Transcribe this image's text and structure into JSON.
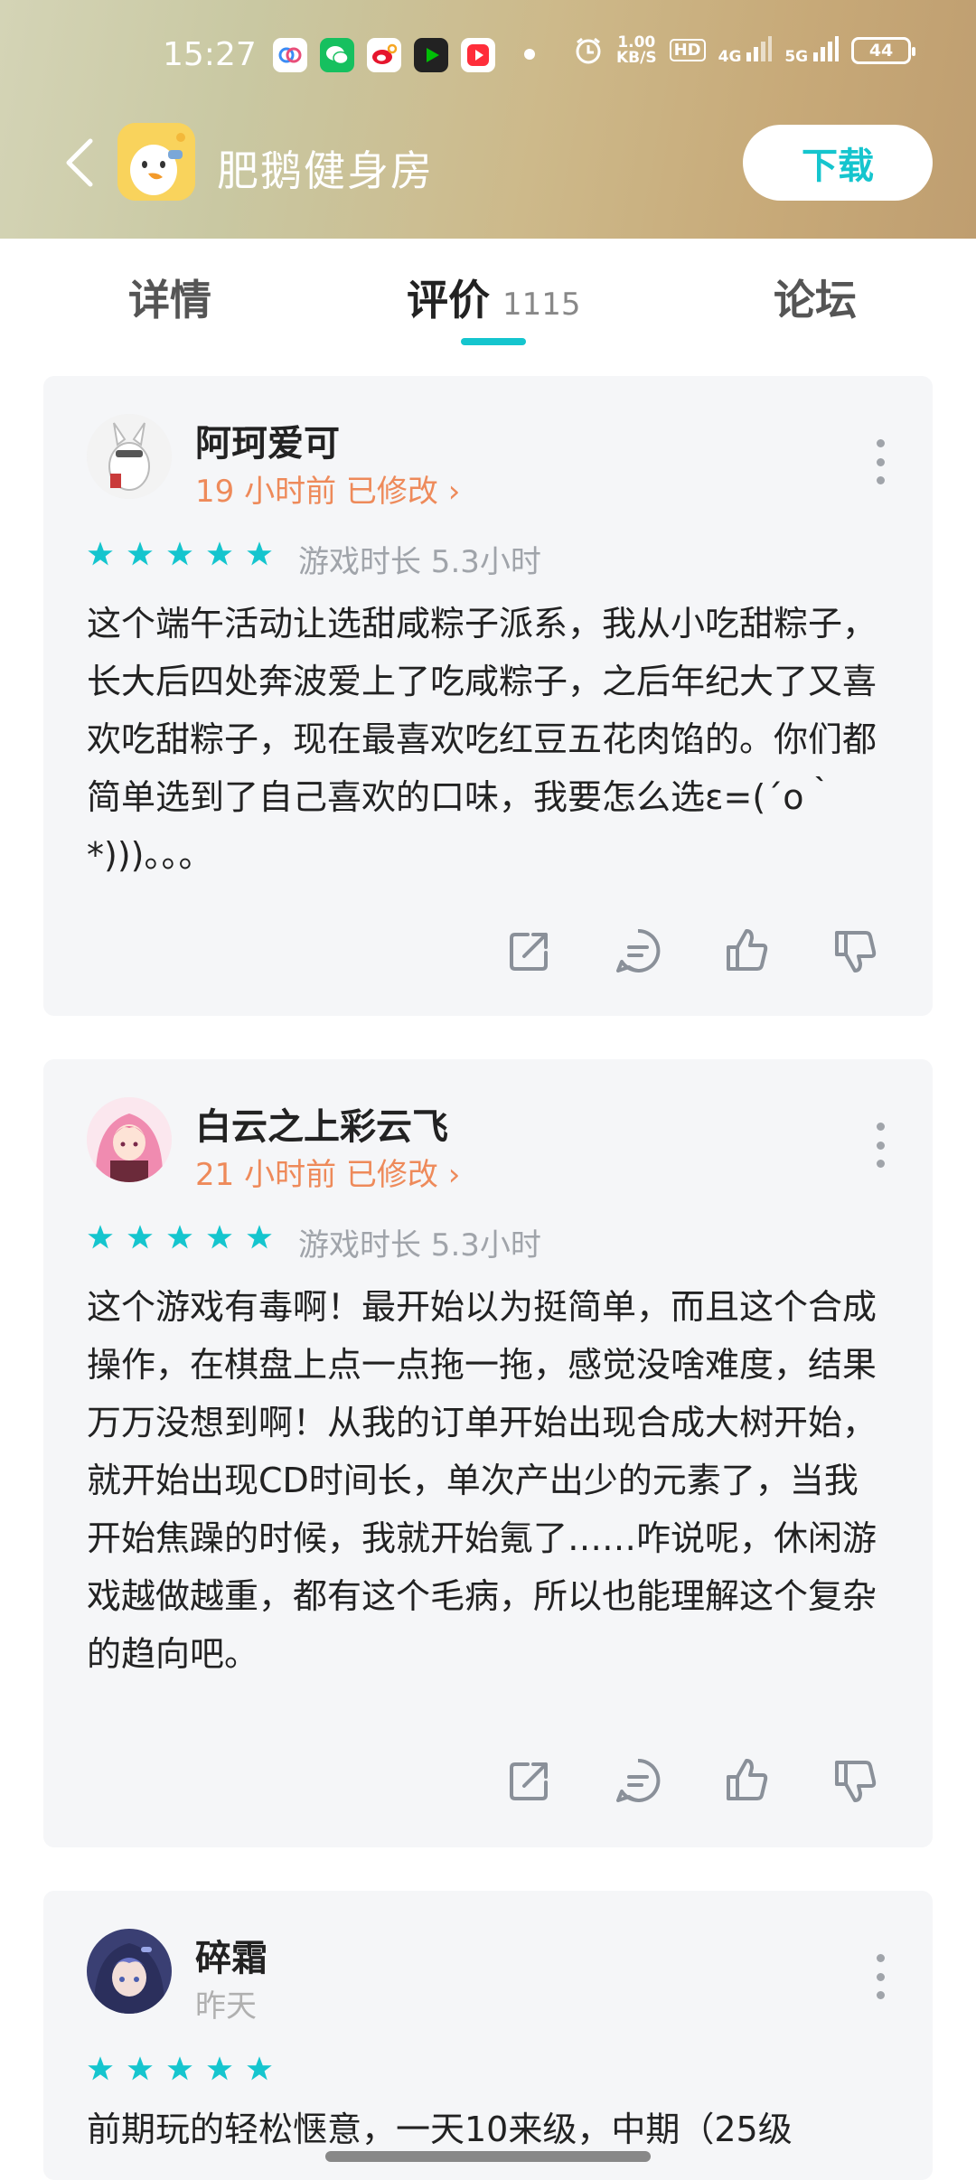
{
  "status_bar": {
    "time": "15:27",
    "speed_value": "1.00",
    "speed_unit": "KB/S",
    "hd": "HD",
    "net4g": "4G",
    "net5g": "5G",
    "battery": "44"
  },
  "header": {
    "app_title": "肥鹅健身房",
    "download_label": "下载",
    "accent_color": "#15c5ce"
  },
  "tabs": [
    {
      "label": "详情"
    },
    {
      "label": "评价",
      "count": "1115",
      "active": true
    },
    {
      "label": "论坛"
    }
  ],
  "reviews": [
    {
      "username": "阿珂爱可",
      "time": "19 小时前",
      "edited": "已修改",
      "chevron": "›",
      "rating": 5,
      "playtime": "游戏时长 5.3小时",
      "text": "这个端午活动让选甜咸粽子派系，我从小吃甜粽子，长大后四处奔波爱上了吃咸粽子，之后年纪大了又喜欢吃甜粽子，现在最喜欢吃红豆五花肉馅的。你们都简单选到了自己喜欢的口味，我要怎么选ε=(´ο｀*)))。。。"
    },
    {
      "username": "白云之上彩云飞",
      "time": "21 小时前",
      "edited": "已修改",
      "chevron": "›",
      "rating": 5,
      "playtime": "游戏时长 5.3小时",
      "text": "这个游戏有毒啊！最开始以为挺简单，而且这个合成操作，在棋盘上点一点拖一拖，感觉没啥难度，结果万万没想到啊！从我的订单开始出现合成大树开始，就开始出现CD时间长，单次产出少的元素了，当我开始焦躁的时候，我就开始氪了……咋说呢，休闲游戏越做越重，都有这个毛病，所以也能理解这个复杂的趋向吧。"
    },
    {
      "username": "碎霜",
      "time": "昨天",
      "rating": 5,
      "text": "前期玩的轻松惬意，一天10来级，中期（25级"
    }
  ]
}
